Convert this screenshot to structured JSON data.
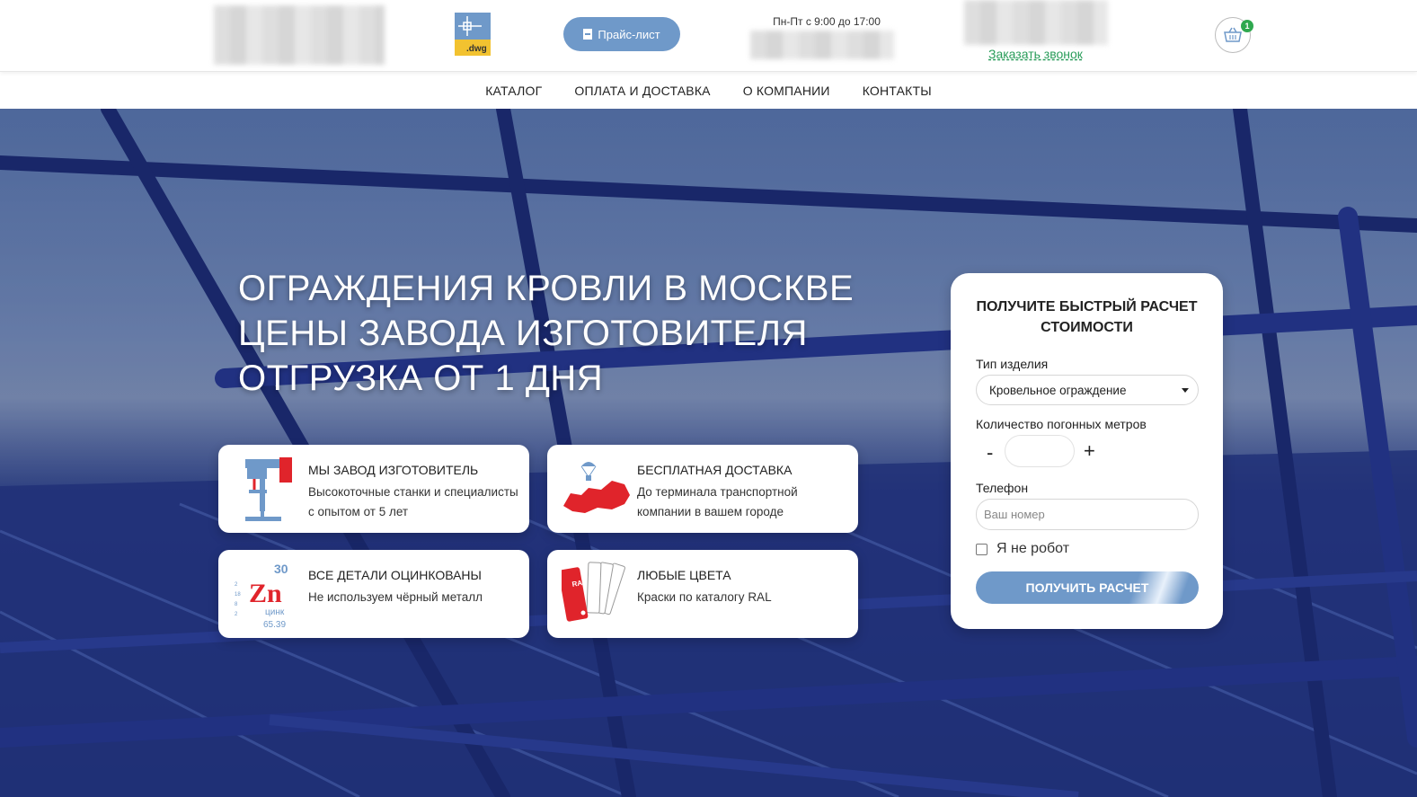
{
  "header": {
    "dwg_label": ".dwg",
    "price_button": "Прайс-лист",
    "hours": "Пн-Пт с 9:00 до 17:00",
    "callback": "Заказать звонок",
    "cart_count": "1"
  },
  "nav": {
    "items": [
      {
        "label": "КАТАЛОГ"
      },
      {
        "label": "ОПЛАТА И ДОСТАВКА"
      },
      {
        "label": "О КОМПАНИИ"
      },
      {
        "label": "КОНТАКТЫ"
      }
    ]
  },
  "hero": {
    "lines": [
      "ОГРАЖДЕНИЯ КРОВЛИ В МОСКВЕ",
      "ЦЕНЫ ЗАВОДА ИЗГОТОВИТЕЛЯ",
      "ОТГРУЗКА ОТ 1 ДНЯ"
    ]
  },
  "features": [
    {
      "title": "МЫ ЗАВОД ИЗГОТОВИТЕЛЬ",
      "text": "Высокоточные станки и специалисты с опытом от 5 лет",
      "icon": "drill-press-icon"
    },
    {
      "title": "БЕСПЛАТНАЯ ДОСТАВКА",
      "text": "До терминала транспортной компании в вашем городе",
      "icon": "russia-map-parachute-icon"
    },
    {
      "title": "ВСЕ ДЕТАЛИ ОЦИНКОВАНЫ",
      "text": "Не используем чёрный металл",
      "icon": "zinc-element-icon"
    },
    {
      "title": "ЛЮБЫЕ ЦВЕТА",
      "text": "Краски по каталогу RAL",
      "icon": "ral-palette-icon"
    }
  ],
  "zinc": {
    "number": "30",
    "symbol": "Zn",
    "name": "цинк",
    "mass": "65.39",
    "shells": [
      "2",
      "18",
      "8",
      "2"
    ]
  },
  "ral_label": "RAL",
  "form": {
    "title": "ПОЛУЧИТЕ БЫСТРЫЙ РАСЧЕТ СТОИМОСТИ",
    "type_label": "Тип изделия",
    "type_value": "Кровельное ограждение",
    "qty_label": "Количество погонных метров",
    "minus": "-",
    "plus": "+",
    "phone_label": "Телефон",
    "phone_placeholder": "Ваш номер",
    "robot_label": "Я не робот",
    "submit": "ПОЛУЧИТЬ РАСЧЕТ"
  },
  "colors": {
    "accent": "#6f99c9",
    "callback": "#2a9d5a",
    "badge": "#2fa84f"
  }
}
